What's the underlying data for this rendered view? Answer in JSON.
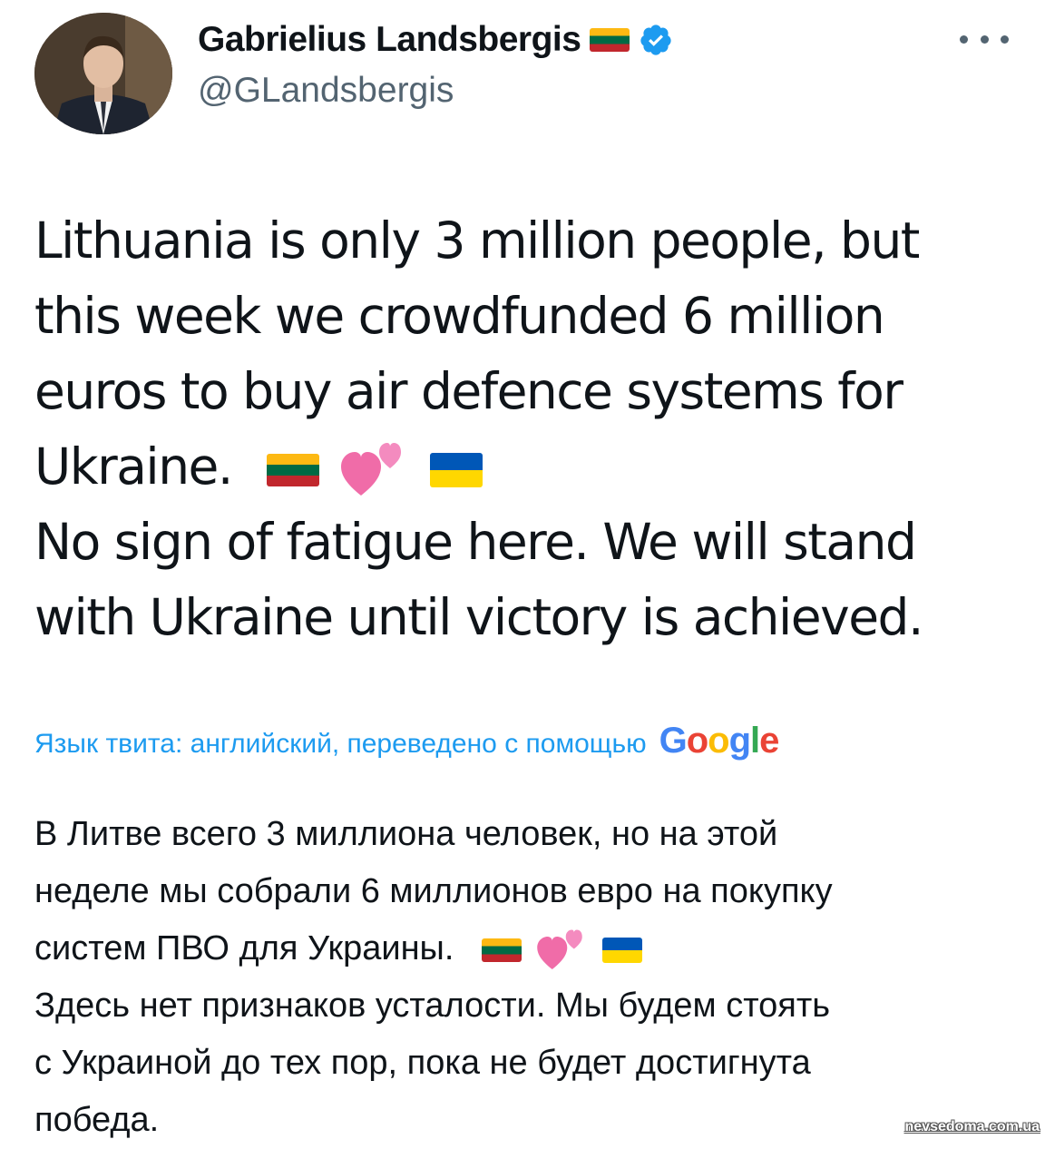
{
  "author": {
    "display_name": "Gabrielius Landsbergis",
    "handle": "@GLandsbergis",
    "verified": true,
    "name_flag": "flag-lithuania"
  },
  "more_menu": {
    "icon": "more-horizontal-icon"
  },
  "tweet": {
    "lines": [
      "Lithuania is only 3 million people, but",
      "this week we crowdfunded 6 million",
      "euros to buy air defence systems for",
      "Ukraine.",
      "No sign of fatigue here. We will stand",
      "with Ukraine until victory is achieved."
    ],
    "emoji": [
      "flag-lithuania",
      "two-hearts",
      "flag-ukraine"
    ]
  },
  "translation": {
    "note": "Язык твита: английский, переведено с помощью",
    "provider": "Google",
    "lines": [
      "В Литве всего 3 миллиона человек, но на этой",
      "неделе мы собрали 6 миллионов евро на покупку",
      "систем ПВО для Украины.",
      "Здесь нет признаков усталости. Мы будем стоять",
      "с Украиной до тех пор, пока не будет достигнута",
      "победа."
    ]
  },
  "watermark": "nevsedoma.com.ua",
  "colors": {
    "link_blue": "#1d9bf0",
    "secondary_text": "#536471",
    "verified_blue": "#1d9bf0",
    "heart_pink": "#f06ca8"
  }
}
